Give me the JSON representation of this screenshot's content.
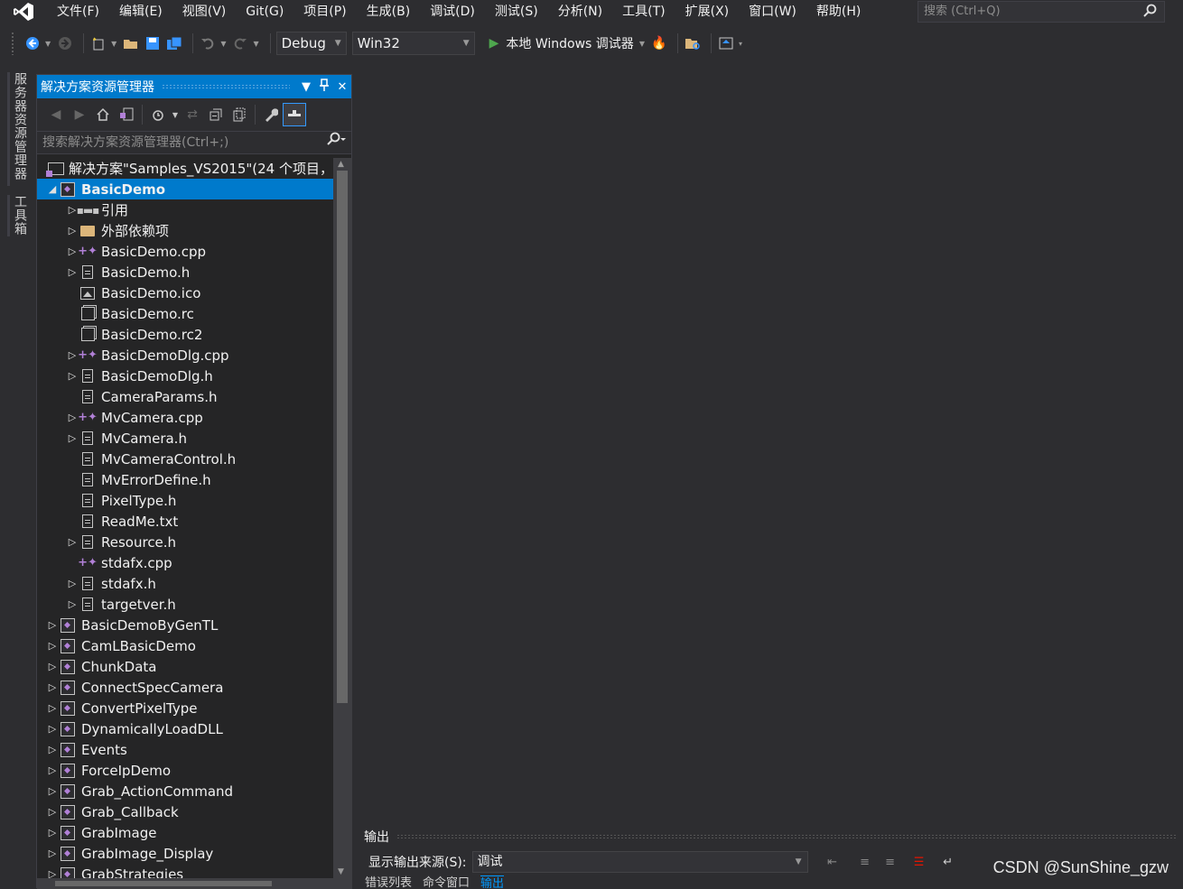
{
  "menu": {
    "items": [
      "文件(F)",
      "编辑(E)",
      "视图(V)",
      "Git(G)",
      "项目(P)",
      "生成(B)",
      "调试(D)",
      "测试(S)",
      "分析(N)",
      "工具(T)",
      "扩展(X)",
      "窗口(W)",
      "帮助(H)"
    ],
    "search_placeholder": "搜索 (Ctrl+Q)"
  },
  "toolbar": {
    "config": "Debug",
    "platform": "Win32",
    "run_label": "本地 Windows 调试器"
  },
  "side_tabs": [
    "服务器资源管理器",
    "工具箱"
  ],
  "solution_explorer": {
    "title": "解决方案资源管理器",
    "search_placeholder": "搜索解决方案资源管理器(Ctrl+;)",
    "solution_label": "解决方案\"Samples_VS2015\"(24 个项目，",
    "tree": [
      {
        "label": "BasicDemo",
        "level": 0,
        "expander": "expanded",
        "icon": "project-icon",
        "selected": true
      },
      {
        "label": "引用",
        "level": 1,
        "expander": "collapsed",
        "icon": "references-icon"
      },
      {
        "label": "外部依赖项",
        "level": 1,
        "expander": "collapsed",
        "icon": "folder-icon"
      },
      {
        "label": "BasicDemo.cpp",
        "level": 1,
        "expander": "collapsed",
        "icon": "cpp-file-icon"
      },
      {
        "label": "BasicDemo.h",
        "level": 1,
        "expander": "collapsed",
        "icon": "header-file-icon"
      },
      {
        "label": "BasicDemo.ico",
        "level": 1,
        "expander": "none",
        "icon": "image-file-icon"
      },
      {
        "label": "BasicDemo.rc",
        "level": 1,
        "expander": "none",
        "icon": "resource-file-icon"
      },
      {
        "label": "BasicDemo.rc2",
        "level": 1,
        "expander": "none",
        "icon": "resource-file-icon"
      },
      {
        "label": "BasicDemoDlg.cpp",
        "level": 1,
        "expander": "collapsed",
        "icon": "cpp-file-icon"
      },
      {
        "label": "BasicDemoDlg.h",
        "level": 1,
        "expander": "collapsed",
        "icon": "header-file-icon"
      },
      {
        "label": "CameraParams.h",
        "level": 1,
        "expander": "none",
        "icon": "header-file-icon"
      },
      {
        "label": "MvCamera.cpp",
        "level": 1,
        "expander": "collapsed",
        "icon": "cpp-file-icon"
      },
      {
        "label": "MvCamera.h",
        "level": 1,
        "expander": "collapsed",
        "icon": "header-file-icon"
      },
      {
        "label": "MvCameraControl.h",
        "level": 1,
        "expander": "none",
        "icon": "header-file-icon"
      },
      {
        "label": "MvErrorDefine.h",
        "level": 1,
        "expander": "none",
        "icon": "header-file-icon"
      },
      {
        "label": "PixelType.h",
        "level": 1,
        "expander": "none",
        "icon": "header-file-icon"
      },
      {
        "label": "ReadMe.txt",
        "level": 1,
        "expander": "none",
        "icon": "text-file-icon"
      },
      {
        "label": "Resource.h",
        "level": 1,
        "expander": "collapsed",
        "icon": "header-file-icon"
      },
      {
        "label": "stdafx.cpp",
        "level": 1,
        "expander": "none",
        "icon": "cpp-file-icon"
      },
      {
        "label": "stdafx.h",
        "level": 1,
        "expander": "collapsed",
        "icon": "header-file-icon"
      },
      {
        "label": "targetver.h",
        "level": 1,
        "expander": "collapsed",
        "icon": "header-file-icon"
      },
      {
        "label": "BasicDemoByGenTL",
        "level": 0,
        "expander": "collapsed",
        "icon": "project-icon"
      },
      {
        "label": "CamLBasicDemo",
        "level": 0,
        "expander": "collapsed",
        "icon": "project-icon"
      },
      {
        "label": "ChunkData",
        "level": 0,
        "expander": "collapsed",
        "icon": "project-icon"
      },
      {
        "label": "ConnectSpecCamera",
        "level": 0,
        "expander": "collapsed",
        "icon": "project-icon"
      },
      {
        "label": "ConvertPixelType",
        "level": 0,
        "expander": "collapsed",
        "icon": "project-icon"
      },
      {
        "label": "DynamicallyLoadDLL",
        "level": 0,
        "expander": "collapsed",
        "icon": "project-icon"
      },
      {
        "label": "Events",
        "level": 0,
        "expander": "collapsed",
        "icon": "project-icon"
      },
      {
        "label": "ForceIpDemo",
        "level": 0,
        "expander": "collapsed",
        "icon": "project-icon"
      },
      {
        "label": "Grab_ActionCommand",
        "level": 0,
        "expander": "collapsed",
        "icon": "project-icon"
      },
      {
        "label": "Grab_Callback",
        "level": 0,
        "expander": "collapsed",
        "icon": "project-icon"
      },
      {
        "label": "GrabImage",
        "level": 0,
        "expander": "collapsed",
        "icon": "project-icon"
      },
      {
        "label": "GrabImage_Display",
        "level": 0,
        "expander": "collapsed",
        "icon": "project-icon"
      },
      {
        "label": "GrabStrategies",
        "level": 0,
        "expander": "collapsed",
        "icon": "project-icon"
      }
    ]
  },
  "output": {
    "title": "输出",
    "source_label": "显示输出来源(S):",
    "source_value": "调试",
    "tabs": [
      "错误列表",
      "命令窗口",
      "输出"
    ],
    "active_tab": "输出"
  },
  "watermark": "CSDN @SunShine_gzw"
}
